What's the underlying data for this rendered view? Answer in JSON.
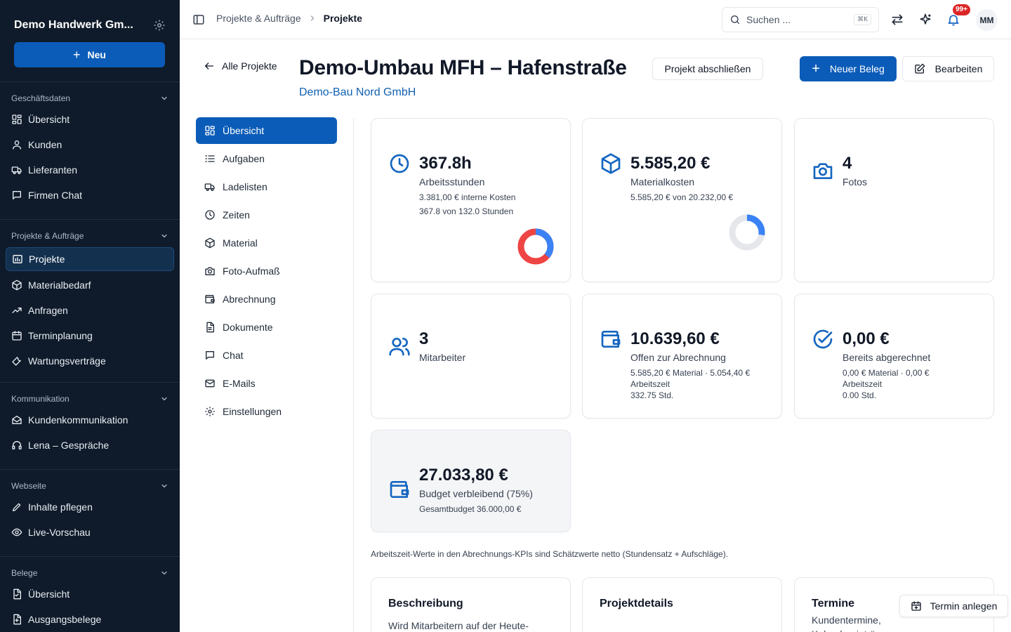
{
  "sidebar": {
    "company": "Demo Handwerk Gm...",
    "new_label": "Neu",
    "sections": [
      {
        "title": "Geschäftsdaten",
        "items": [
          {
            "label": "Übersicht",
            "icon": "grid-icon"
          },
          {
            "label": "Kunden",
            "icon": "user-icon"
          },
          {
            "label": "Lieferanten",
            "icon": "truck-icon"
          },
          {
            "label": "Firmen Chat",
            "icon": "chat-icon"
          }
        ]
      },
      {
        "title": "Projekte & Aufträge",
        "items": [
          {
            "label": "Projekte",
            "icon": "projects-icon",
            "active": true
          },
          {
            "label": "Materialbedarf",
            "icon": "box-icon"
          },
          {
            "label": "Anfragen",
            "icon": "trend-icon"
          },
          {
            "label": "Terminplanung",
            "icon": "calendar-icon"
          },
          {
            "label": "Wartungsverträge",
            "icon": "wrench-icon"
          }
        ]
      },
      {
        "title": "Kommunikation",
        "items": [
          {
            "label": "Kundenkommunikation",
            "icon": "mail-open-icon"
          },
          {
            "label": "Lena – Gespräche",
            "icon": "headphones-icon"
          }
        ]
      },
      {
        "title": "Webseite",
        "items": [
          {
            "label": "Inhalte pflegen",
            "icon": "pen-icon"
          },
          {
            "label": "Live-Vorschau",
            "icon": "eye-icon"
          }
        ]
      },
      {
        "title": "Belege",
        "items": [
          {
            "label": "Übersicht",
            "icon": "doc-check-icon"
          },
          {
            "label": "Ausgangsbelege",
            "icon": "doc-out-icon"
          }
        ]
      }
    ]
  },
  "topbar": {
    "breadcrumb": [
      "Projekte & Aufträge",
      "Projekte"
    ],
    "search_placeholder": "Suchen ...",
    "search_shortcut": "⌘K",
    "notification_count": "99+",
    "avatar_initials": "MM"
  },
  "header": {
    "back_label": "Alle Projekte",
    "title": "Demo-Umbau MFH – Hafenstraße",
    "client": "Demo-Bau Nord GmbH",
    "close_project_label": "Projekt abschließen",
    "new_doc_label": "Neuer Beleg",
    "edit_label": "Bearbeiten"
  },
  "subnav": [
    {
      "label": "Übersicht",
      "icon": "grid-icon",
      "active": true
    },
    {
      "label": "Aufgaben",
      "icon": "tasks-icon"
    },
    {
      "label": "Ladelisten",
      "icon": "truck-icon"
    },
    {
      "label": "Zeiten",
      "icon": "clock-icon"
    },
    {
      "label": "Material",
      "icon": "box-icon"
    },
    {
      "label": "Foto-Aufmaß",
      "icon": "camera-icon"
    },
    {
      "label": "Abrechnung",
      "icon": "wallet-icon"
    },
    {
      "label": "Dokumente",
      "icon": "document-icon"
    },
    {
      "label": "Chat",
      "icon": "chat-icon"
    },
    {
      "label": "E-Mails",
      "icon": "mail-icon"
    },
    {
      "label": "Einstellungen",
      "icon": "gear-icon"
    }
  ],
  "kpis": {
    "hours": {
      "value": "367.8h",
      "label": "Arbeitsstunden",
      "sub1": "3.381,00 € interne Kosten",
      "sub2": "367.8 von 132.0 Stunden",
      "progress": 1.0,
      "colors": [
        "#ef4444",
        "#3b82f6"
      ]
    },
    "material": {
      "value": "5.585,20 €",
      "label": "Materialkosten",
      "sub1": "5.585,20 € von 20.232,00 €",
      "progress": 0.276,
      "colors": [
        "#3b82f6",
        "#e5e7eb"
      ]
    },
    "photos": {
      "value": "4",
      "label": "Fotos"
    },
    "staff": {
      "value": "3",
      "label": "Mitarbeiter"
    },
    "open": {
      "value": "10.639,60 €",
      "label": "Offen zur Abrechnung",
      "sub1": "5.585,20 € Material · 5.054,40 € Arbeitszeit",
      "sub2": "332.75 Std."
    },
    "billed": {
      "value": "0,00 €",
      "label": "Bereits abgerechnet",
      "sub1": "0,00 € Material · 0,00 € Arbeitszeit",
      "sub2": "0.00 Std."
    },
    "budget": {
      "value": "27.033,80 €",
      "label": "Budget verbleibend (75%)",
      "sub1": "Gesamtbudget 36.000,00 €"
    }
  },
  "note": "Arbeitszeit-Werte in den Abrechnungs-KPIs sind Schätzwerte netto (Stundensatz + Aufschläge).",
  "bottom_cards": {
    "description": {
      "title": "Beschreibung",
      "text": "Wird Mitarbeitern auf der Heute-"
    },
    "details": {
      "title": "Projektdetails"
    },
    "appointments": {
      "title": "Termine",
      "text": "Kundentermine, Kalendereinträge"
    }
  },
  "termin_button": "Termin anlegen"
}
